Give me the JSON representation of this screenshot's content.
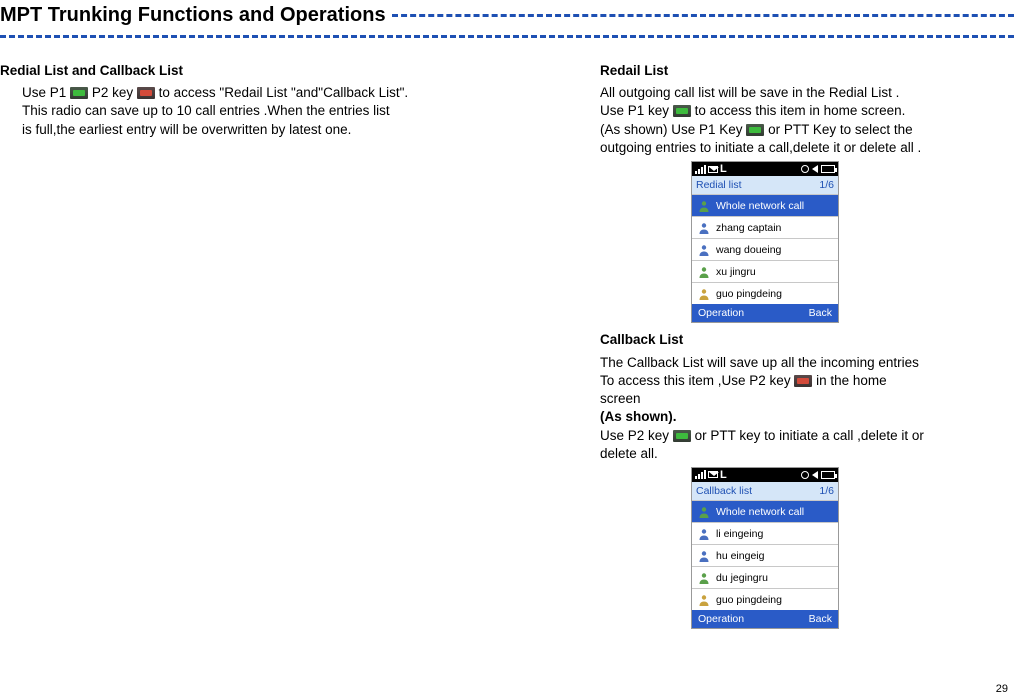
{
  "page_title": "MPT Trunking Functions and Operations",
  "page_number": "29",
  "left": {
    "heading": "Redial List and Callback List",
    "line1a": "Use P1",
    "line1b": "P2 key",
    "line1c": "to access \"Redail List \"and\"Callback List\".",
    "line2": "This radio can save up to 10 call entries .When the entries list",
    "line3": "is full,the earliest entry will be overwritten by latest one."
  },
  "right": {
    "redial": {
      "heading": "Redail List",
      "line1": "All outgoing call list will be save  in the Redial List .",
      "line2a": "Use P1 key",
      "line2b": "to access this item in  home screen.",
      "line3a": "(As shown) Use P1 Key",
      "line3b": "or PTT Key to select the",
      "line4": "outgoing entries to initiate a call,delete it or delete all ."
    },
    "callback": {
      "heading": "Callback List",
      "line1": "The Callback List  will save up all the incoming entries",
      "line2a": "To access this item ,Use  P2 key",
      "line2b": "in the home screen",
      "line3": "(As shown).",
      "line4a": "Use P2 key",
      "line4b": "or PTT key to initiate a call ,delete it or",
      "line5": "delete all."
    }
  },
  "phone_redial": {
    "status_L": "L",
    "header_left": "Redial list",
    "header_right": "1/6",
    "rows": [
      {
        "label": "Whole network call",
        "sel": true,
        "av": "green"
      },
      {
        "label": "zhang captain",
        "sel": false,
        "av": "blue"
      },
      {
        "label": "wang doueing",
        "sel": false,
        "av": "blue"
      },
      {
        "label": "xu jingru",
        "sel": false,
        "av": "green"
      },
      {
        "label": "guo pingdeing",
        "sel": false,
        "av": "yellow"
      }
    ],
    "footer_left": "Operation",
    "footer_right": "Back"
  },
  "phone_callback": {
    "status_L": "L",
    "header_left": "Callback list",
    "header_right": "1/6",
    "rows": [
      {
        "label": "Whole network call",
        "sel": true,
        "av": "green"
      },
      {
        "label": "li eingeing",
        "sel": false,
        "av": "blue"
      },
      {
        "label": "hu eingeig",
        "sel": false,
        "av": "blue"
      },
      {
        "label": "du jegingru",
        "sel": false,
        "av": "green"
      },
      {
        "label": "guo pingdeing",
        "sel": false,
        "av": "yellow"
      }
    ],
    "footer_left": "Operation",
    "footer_right": "Back"
  }
}
